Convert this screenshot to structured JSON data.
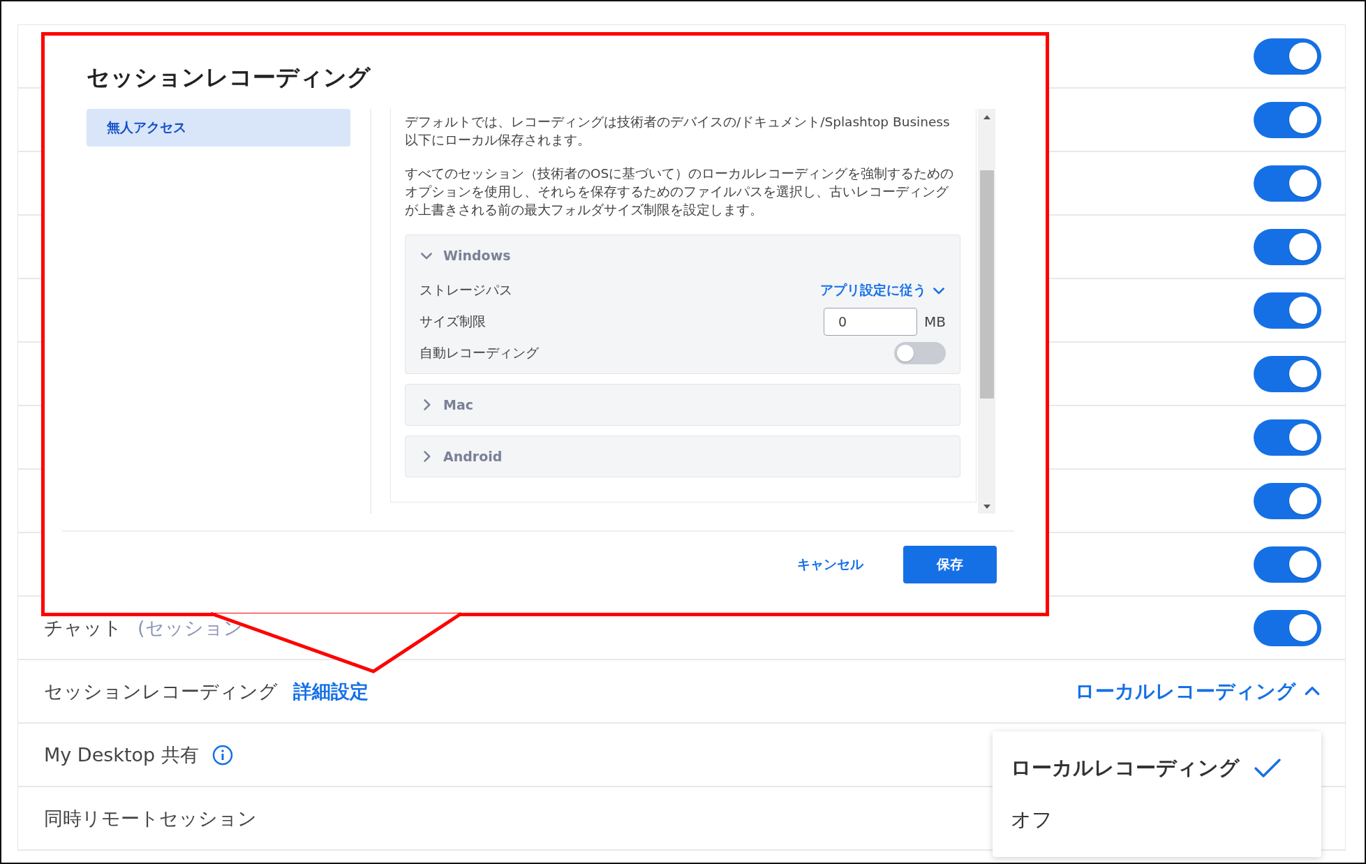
{
  "settings_rows": [
    {
      "kind": "toggle",
      "on": true
    },
    {
      "kind": "toggle",
      "on": true
    },
    {
      "kind": "toggle",
      "on": true
    },
    {
      "kind": "toggle",
      "on": true
    },
    {
      "kind": "toggle",
      "on": true
    },
    {
      "kind": "toggle",
      "on": true
    },
    {
      "kind": "toggle",
      "on": true
    },
    {
      "kind": "toggle",
      "on": true
    },
    {
      "kind": "toggle",
      "on": true
    },
    {
      "kind": "toggle",
      "label": "チャット",
      "note": "(セッション",
      "on": true
    },
    {
      "kind": "select",
      "label": "セッションレコーディング",
      "link": "詳細設定",
      "value": "ローカルレコーディング",
      "expanded": true
    },
    {
      "kind": "info",
      "label": "My Desktop 共有"
    },
    {
      "kind": "plain",
      "label": "同時リモートセッション"
    }
  ],
  "dialog": {
    "title": "セッションレコーディング",
    "nav": [
      {
        "label": "無人アクセス",
        "selected": true
      }
    ],
    "paragraphs": [
      "デフォルトでは、レコーディングは技術者のデバイスの/ドキュメント/Splashtop Business以下にローカル保存されます。",
      "すべてのセッション（技術者のOSに基づいて）のローカルレコーディングを強制するためのオプションを使用し、それらを保存するためのファイルパスを選択し、古いレコーディングが上書きされる前の最大フォルダサイズ制限を設定します。"
    ],
    "sections": [
      {
        "name": "Windows",
        "expanded": true,
        "fields": [
          {
            "kind": "select",
            "label": "ストレージパス",
            "value": "アプリ設定に従う"
          },
          {
            "kind": "number",
            "label": "サイズ制限",
            "value": "0",
            "unit": "MB"
          },
          {
            "kind": "toggle",
            "label": "自動レコーディング",
            "on": false
          }
        ]
      },
      {
        "name": "Mac",
        "expanded": false
      },
      {
        "name": "Android",
        "expanded": false
      }
    ],
    "buttons": [
      {
        "label": "キャンセル",
        "kind": "secondary"
      },
      {
        "label": "保存",
        "kind": "primary"
      }
    ]
  },
  "dropdown": {
    "options": [
      {
        "label": "ローカルレコーディング",
        "selected": true
      },
      {
        "label": "オフ",
        "selected": false
      }
    ]
  }
}
